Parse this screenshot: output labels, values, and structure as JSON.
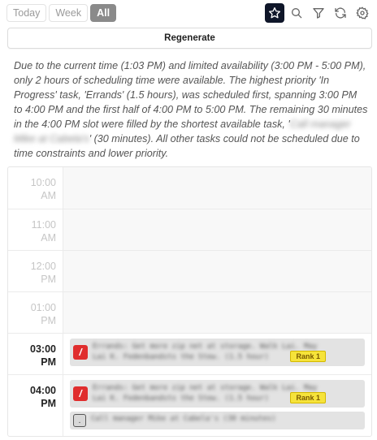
{
  "view_tabs": [
    {
      "label": "Today",
      "active": false
    },
    {
      "label": "Week",
      "active": false
    },
    {
      "label": "All",
      "active": true
    }
  ],
  "tools": [
    {
      "name": "star-icon"
    },
    {
      "name": "search-icon"
    },
    {
      "name": "filter-icon"
    },
    {
      "name": "refresh-icon"
    },
    {
      "name": "settings-icon"
    }
  ],
  "regenerate_label": "Regenerate",
  "explanation": {
    "before": "Due to the current time (1:03 PM) and limited availability (3:00 PM - 5:00 PM), only 2 hours of scheduling time were available. The highest priority 'In Progress' task, 'Errands' (1.5 hours), was scheduled first, spanning 3:00 PM to 4:00 PM and the first half of 4:00 PM to 5:00 PM. The remaining 30 minutes in the 4:00 PM slot were filled by the shortest available task, '",
    "redacted": "Call manager Mike at Cabela's",
    "after": "' (30 minutes). All other tasks could not be scheduled due to time constraints and lower priority."
  },
  "slots": [
    {
      "hour": "10:00",
      "ampm": "AM"
    },
    {
      "hour": "11:00",
      "ampm": "AM"
    },
    {
      "hour": "12:00",
      "ampm": "PM"
    },
    {
      "hour": "01:00",
      "ampm": "PM"
    },
    {
      "hour": "03:00",
      "ampm": "PM"
    },
    {
      "hour": "04:00",
      "ampm": "PM"
    }
  ],
  "tasks": {
    "errands_3pm": {
      "text": "Errands: Get more zip net at storage. Walk Lai. May Lai K. Fedenbandsts the Stew. (1.5 hour)",
      "rank": "Rank 1"
    },
    "errands_4pm": {
      "text": "Errands: Get more zip net at storage. Walk Lai. May Lai K. Fedenbandsts the Stew. (1.5 hour)",
      "rank": "Rank 1"
    },
    "call_4pm": {
      "text": "Call manager Mike at Cabela's (30 minutes)"
    }
  },
  "colors": {
    "accent_dark": "#0f1629",
    "tab_active": "#8a8a8a",
    "priority_red": "#e02d2d",
    "rank_yellow": "#f6e33a"
  }
}
